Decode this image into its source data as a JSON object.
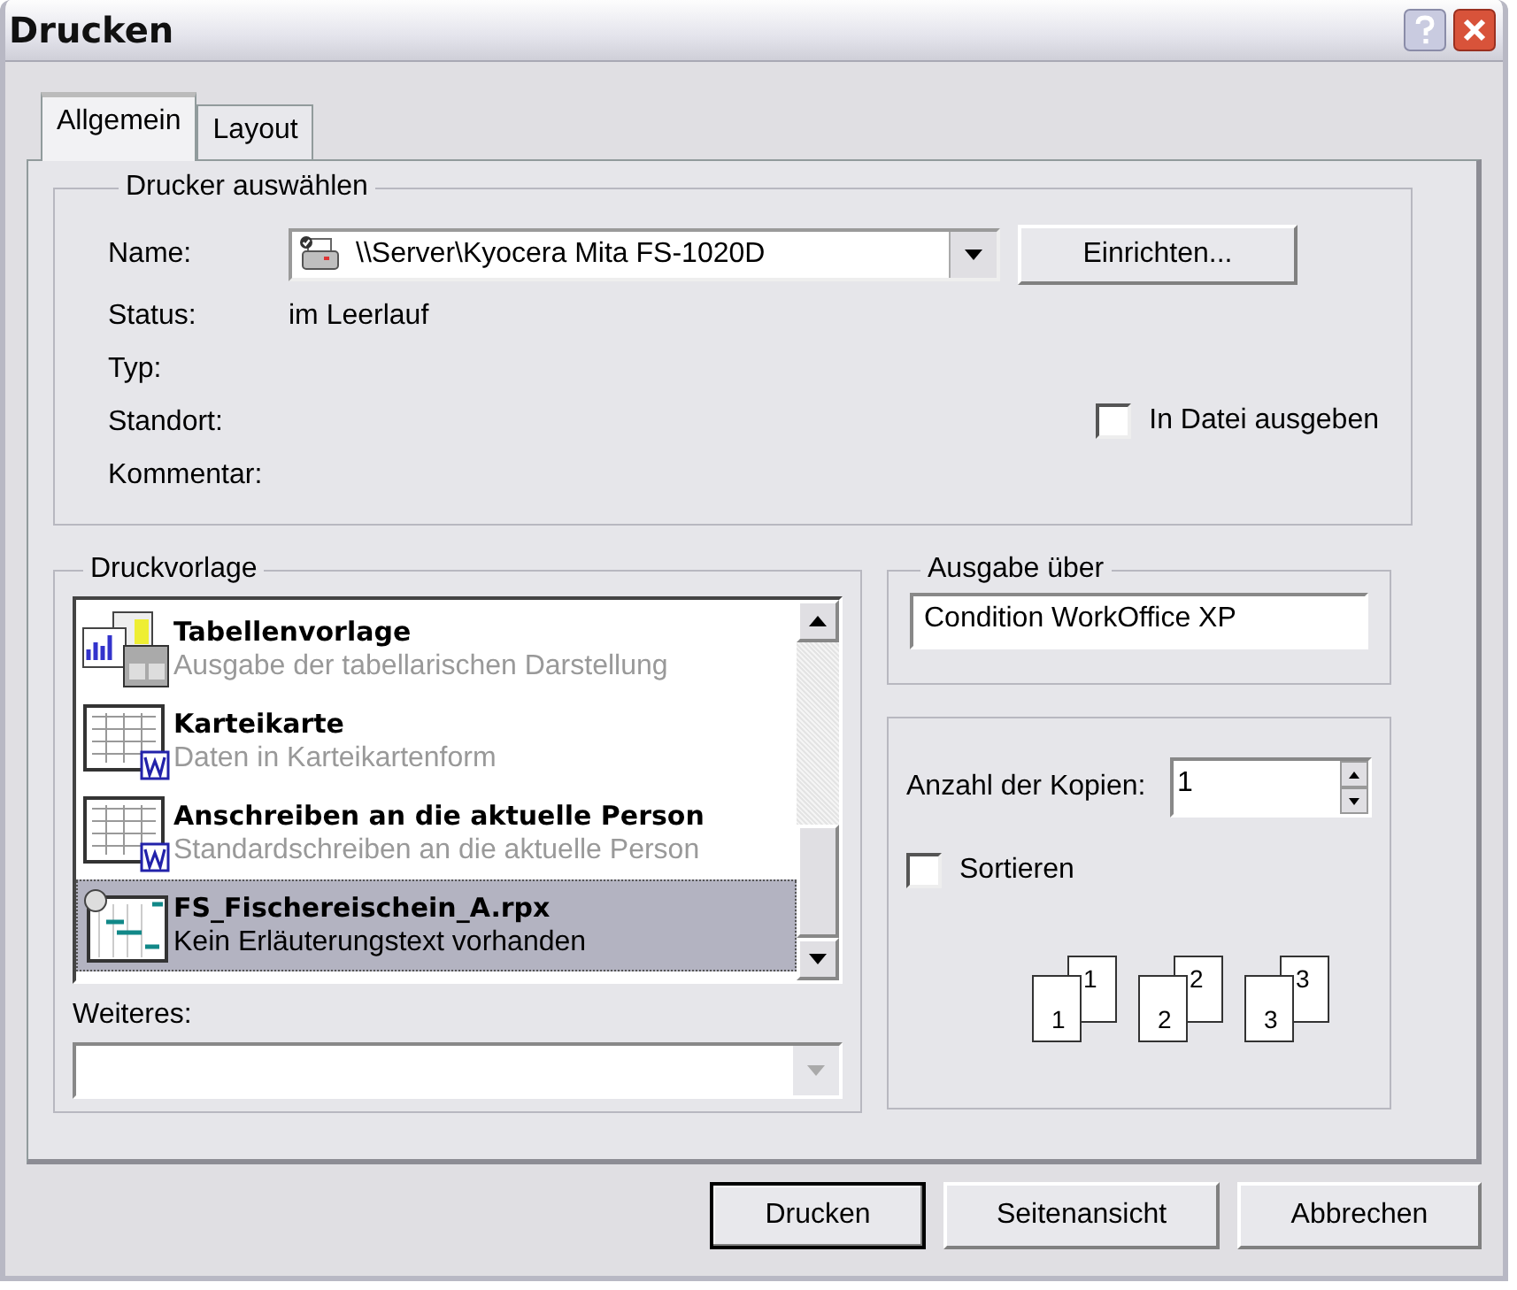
{
  "window": {
    "title": "Drucken"
  },
  "tabs": [
    {
      "label": "Allgemein",
      "selected": true
    },
    {
      "label": "Layout",
      "selected": false
    }
  ],
  "printer_group": {
    "title": "Drucker auswählen",
    "name_label": "Name:",
    "printer": "\\\\Server\\Kyocera Mita FS-1020D",
    "setup_button": "Einrichten...",
    "info": [
      {
        "label": "Status:",
        "value": "im Leerlauf"
      },
      {
        "label": "Typ:"
      },
      {
        "label": "Standort:"
      },
      {
        "label": "Kommentar:"
      }
    ],
    "print_to_file": {
      "label": "In Datei ausgeben",
      "checked": false
    }
  },
  "template_group": {
    "title": "Druckvorlage",
    "templates": [
      {
        "name": "Tabellenvorlage",
        "description": "Ausgabe der tabellarischen Darstellung",
        "kind": "chart-table",
        "selected": false
      },
      {
        "name": "Karteikarte",
        "description": "Daten in Karteikartenform",
        "kind": "word-table",
        "selected": false
      },
      {
        "name": "Anschreiben an die aktuelle Person",
        "description": "Standardschreiben an die aktuelle Person",
        "kind": "word-table",
        "selected": false
      },
      {
        "name": "FS_Fischereischein_A.rpx",
        "description": "Kein Erläuterungstext vorhanden",
        "kind": "report",
        "selected": true
      }
    ],
    "more_label": "Weiteres:",
    "more_disabled": true
  },
  "output_group": {
    "title": "Ausgabe über",
    "value": "Condition WorkOffice XP"
  },
  "copies_group": {
    "label": "Anzahl der Kopien:",
    "value": "1",
    "collate": {
      "label": "Sortieren",
      "checked": false
    },
    "pages": [
      {
        "front": "1",
        "back": "1"
      },
      {
        "front": "2",
        "back": "2"
      },
      {
        "front": "3",
        "back": "3"
      }
    ]
  },
  "buttons": [
    {
      "label": "Drucken",
      "default": true
    },
    {
      "label": "Seitenansicht",
      "default": false
    },
    {
      "label": "Abbrechen",
      "default": false
    }
  ]
}
